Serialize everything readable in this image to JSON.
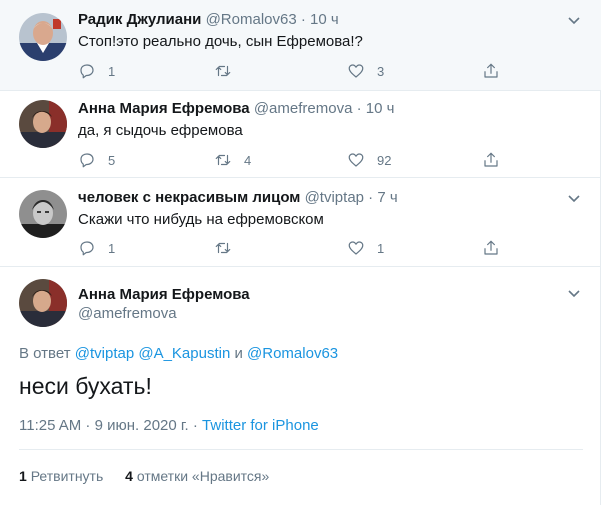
{
  "replies": [
    {
      "name": "Радик Джулиани",
      "handle": "@Romalov63",
      "dot": "·",
      "time": "10 ч",
      "text": "Стоп!это реально дочь, сын Ефремова!?",
      "reply_count": "1",
      "retweet_count": "",
      "like_count": "3"
    },
    {
      "name": "Анна Мария Ефремова",
      "handle": "@amefremova",
      "dot": "·",
      "time": "10 ч",
      "text": "да, я сыдочь ефремова",
      "reply_count": "5",
      "retweet_count": "4",
      "like_count": "92"
    },
    {
      "name": "человек с некрасивым лицом",
      "handle": "@tviptap",
      "dot": "·",
      "time": "7 ч",
      "text": "Скажи что нибудь на ефремовском",
      "reply_count": "1",
      "retweet_count": "",
      "like_count": "1"
    }
  ],
  "main": {
    "name": "Анна Мария Ефремова",
    "handle": "@amefremova",
    "reply_prefix": "В ответ",
    "mention1": "@tviptap",
    "mention2": "@A_Kapustin",
    "conj": "и",
    "mention3": "@Romalov63",
    "text": "неси бухать!",
    "timestamp": "11:25 AM · 9 июн. 2020 г. ·",
    "client": "Twitter for iPhone",
    "retweet_num": "1",
    "retweet_label": "Ретвитнуть",
    "like_num": "4",
    "like_label": "отметки «Нравится»"
  },
  "colors": {
    "accent": "#1b95e0",
    "muted": "#657786",
    "text": "#14171a",
    "highlight_bg": "#f5f8fa"
  },
  "icons": [
    "reply-icon",
    "retweet-icon",
    "like-icon",
    "share-icon",
    "chevron-down-icon"
  ]
}
